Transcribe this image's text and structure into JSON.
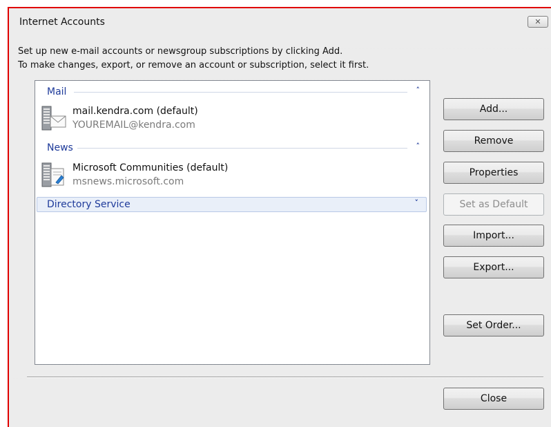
{
  "window": {
    "title": "Internet Accounts",
    "close_glyph": "✕"
  },
  "instructions": {
    "line1": "Set up new e-mail accounts or newsgroup subscriptions by clicking Add.",
    "line2": "To make changes, export, or remove an account or subscription, select it first."
  },
  "groups": {
    "mail": {
      "label": "Mail",
      "chevron": "˄",
      "account": {
        "name": "mail.kendra.com (default)",
        "detail": "YOUREMAIL@kendra.com",
        "icon": "mail-server-icon"
      }
    },
    "news": {
      "label": "News",
      "chevron": "˄",
      "account": {
        "name": "Microsoft Communities (default)",
        "detail": "msnews.microsoft.com",
        "icon": "news-server-icon"
      }
    },
    "directory": {
      "label": "Directory Service",
      "chevron": "˅"
    }
  },
  "buttons": {
    "add": "Add...",
    "remove": "Remove",
    "properties": "Properties",
    "set_default": "Set as Default",
    "import": "Import...",
    "export": "Export...",
    "set_order": "Set Order...",
    "close": "Close"
  },
  "colors": {
    "group_header": "#1e3a9a",
    "window_border": "#e00000"
  }
}
